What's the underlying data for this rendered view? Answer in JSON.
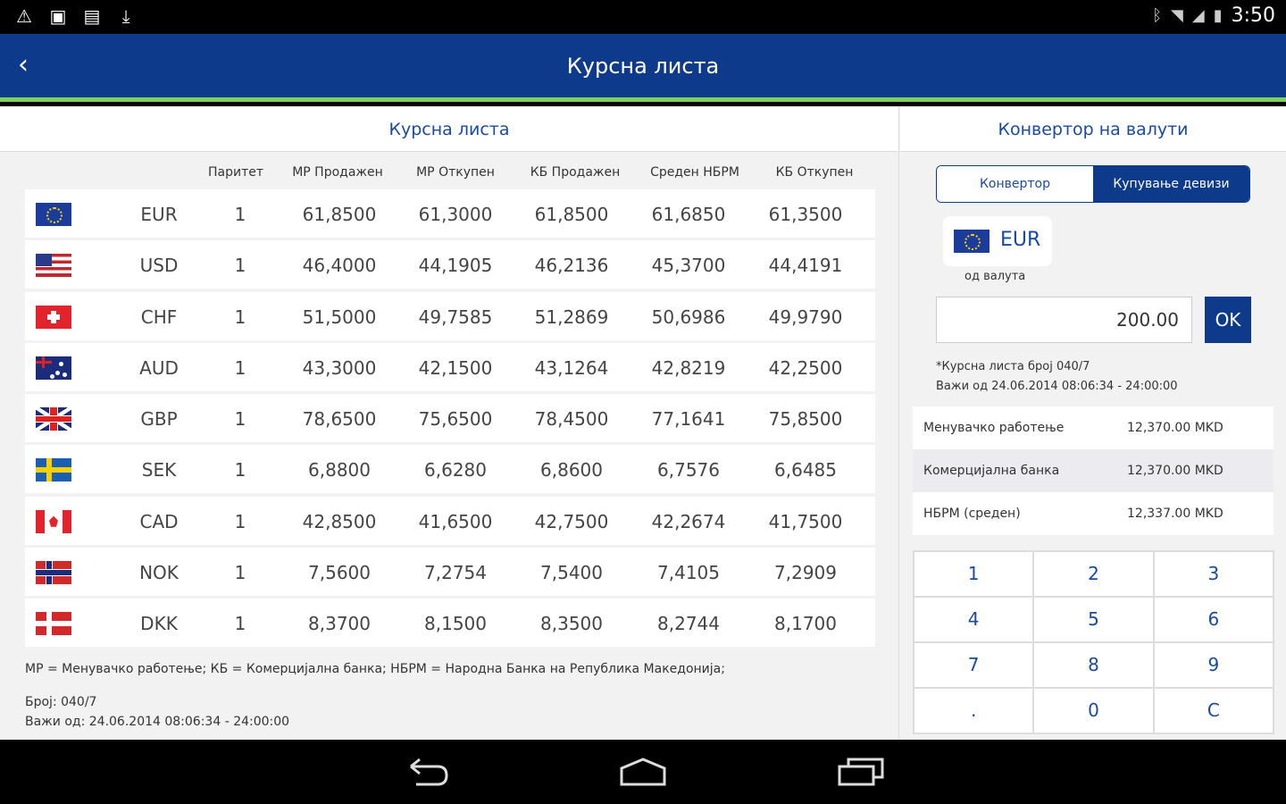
{
  "app_bar": {
    "title": "Курсна листа"
  },
  "status_bar": {
    "time": "3:50"
  },
  "rates": {
    "section_title": "Курсна листа",
    "headers": [
      "Паритет",
      "МР Продажен",
      "МР Откупен",
      "КБ Продажен",
      "Среден НБРМ",
      "КБ Откупен"
    ],
    "rows": [
      {
        "flag": "eu-flag-icon",
        "code": "EUR",
        "parity": "1",
        "mr_sell": "61,8500",
        "mr_buy": "61,3000",
        "kb_sell": "61,8500",
        "nbrm_mid": "61,6850",
        "kb_buy": "61,3500"
      },
      {
        "flag": "us-flag-icon",
        "code": "USD",
        "parity": "1",
        "mr_sell": "46,4000",
        "mr_buy": "44,1905",
        "kb_sell": "46,2136",
        "nbrm_mid": "45,3700",
        "kb_buy": "44,4191"
      },
      {
        "flag": "ch-flag-icon",
        "code": "CHF",
        "parity": "1",
        "mr_sell": "51,5000",
        "mr_buy": "49,7585",
        "kb_sell": "51,2869",
        "nbrm_mid": "50,6986",
        "kb_buy": "49,9790"
      },
      {
        "flag": "au-flag-icon",
        "code": "AUD",
        "parity": "1",
        "mr_sell": "43,3000",
        "mr_buy": "42,1500",
        "kb_sell": "43,1264",
        "nbrm_mid": "42,8219",
        "kb_buy": "42,2500"
      },
      {
        "flag": "gb-flag-icon",
        "code": "GBP",
        "parity": "1",
        "mr_sell": "78,6500",
        "mr_buy": "75,6500",
        "kb_sell": "78,4500",
        "nbrm_mid": "77,1641",
        "kb_buy": "75,8500"
      },
      {
        "flag": "se-flag-icon",
        "code": "SEK",
        "parity": "1",
        "mr_sell": "6,8800",
        "mr_buy": "6,6280",
        "kb_sell": "6,8600",
        "nbrm_mid": "6,7576",
        "kb_buy": "6,6485"
      },
      {
        "flag": "ca-flag-icon",
        "code": "CAD",
        "parity": "1",
        "mr_sell": "42,8500",
        "mr_buy": "41,6500",
        "kb_sell": "42,7500",
        "nbrm_mid": "42,2674",
        "kb_buy": "41,7500"
      },
      {
        "flag": "no-flag-icon",
        "code": "NOK",
        "parity": "1",
        "mr_sell": "7,5600",
        "mr_buy": "7,2754",
        "kb_sell": "7,5400",
        "nbrm_mid": "7,4105",
        "kb_buy": "7,2909"
      },
      {
        "flag": "dk-flag-icon",
        "code": "DKK",
        "parity": "1",
        "mr_sell": "8,3700",
        "mr_buy": "8,1500",
        "kb_sell": "8,3500",
        "nbrm_mid": "8,2744",
        "kb_buy": "8,1700"
      }
    ],
    "legend": "МР = Менувачко работење; КБ = Комерцијална банка; НБРМ = Народна Банка на Република Македонија;",
    "issue_number": "Број: 040/7",
    "valid_from": "Важи од: 24.06.2014  08:06:34 - 24:00:00"
  },
  "converter": {
    "section_title": "Конвертор на валути",
    "tab_converter": "Конвертор",
    "tab_buy": "Купување девизи",
    "currency_code": "EUR",
    "currency_flag": "eu-flag-icon",
    "from_label": "од валута",
    "amount": "200.00",
    "ok_label": "OK",
    "note_line1": "*Курсна листа број 040/7",
    "note_line2": "Важи од 24.06.2014  08:06:34 - 24:00:00",
    "results": [
      {
        "label": "Менувачко работење",
        "value": "12,370.00 MKD"
      },
      {
        "label": "Комерцијална банка",
        "value": "12,370.00 MKD"
      },
      {
        "label": "НБРМ (среден)",
        "value": "12,337.00 MKD"
      }
    ],
    "keypad": [
      "1",
      "2",
      "3",
      "4",
      "5",
      "6",
      "7",
      "8",
      "9",
      ".",
      "0",
      "C"
    ]
  },
  "colors": {
    "primary": "#0e3a8c",
    "accent_line": "#7fcf5e",
    "link": "#1a4aa0"
  }
}
